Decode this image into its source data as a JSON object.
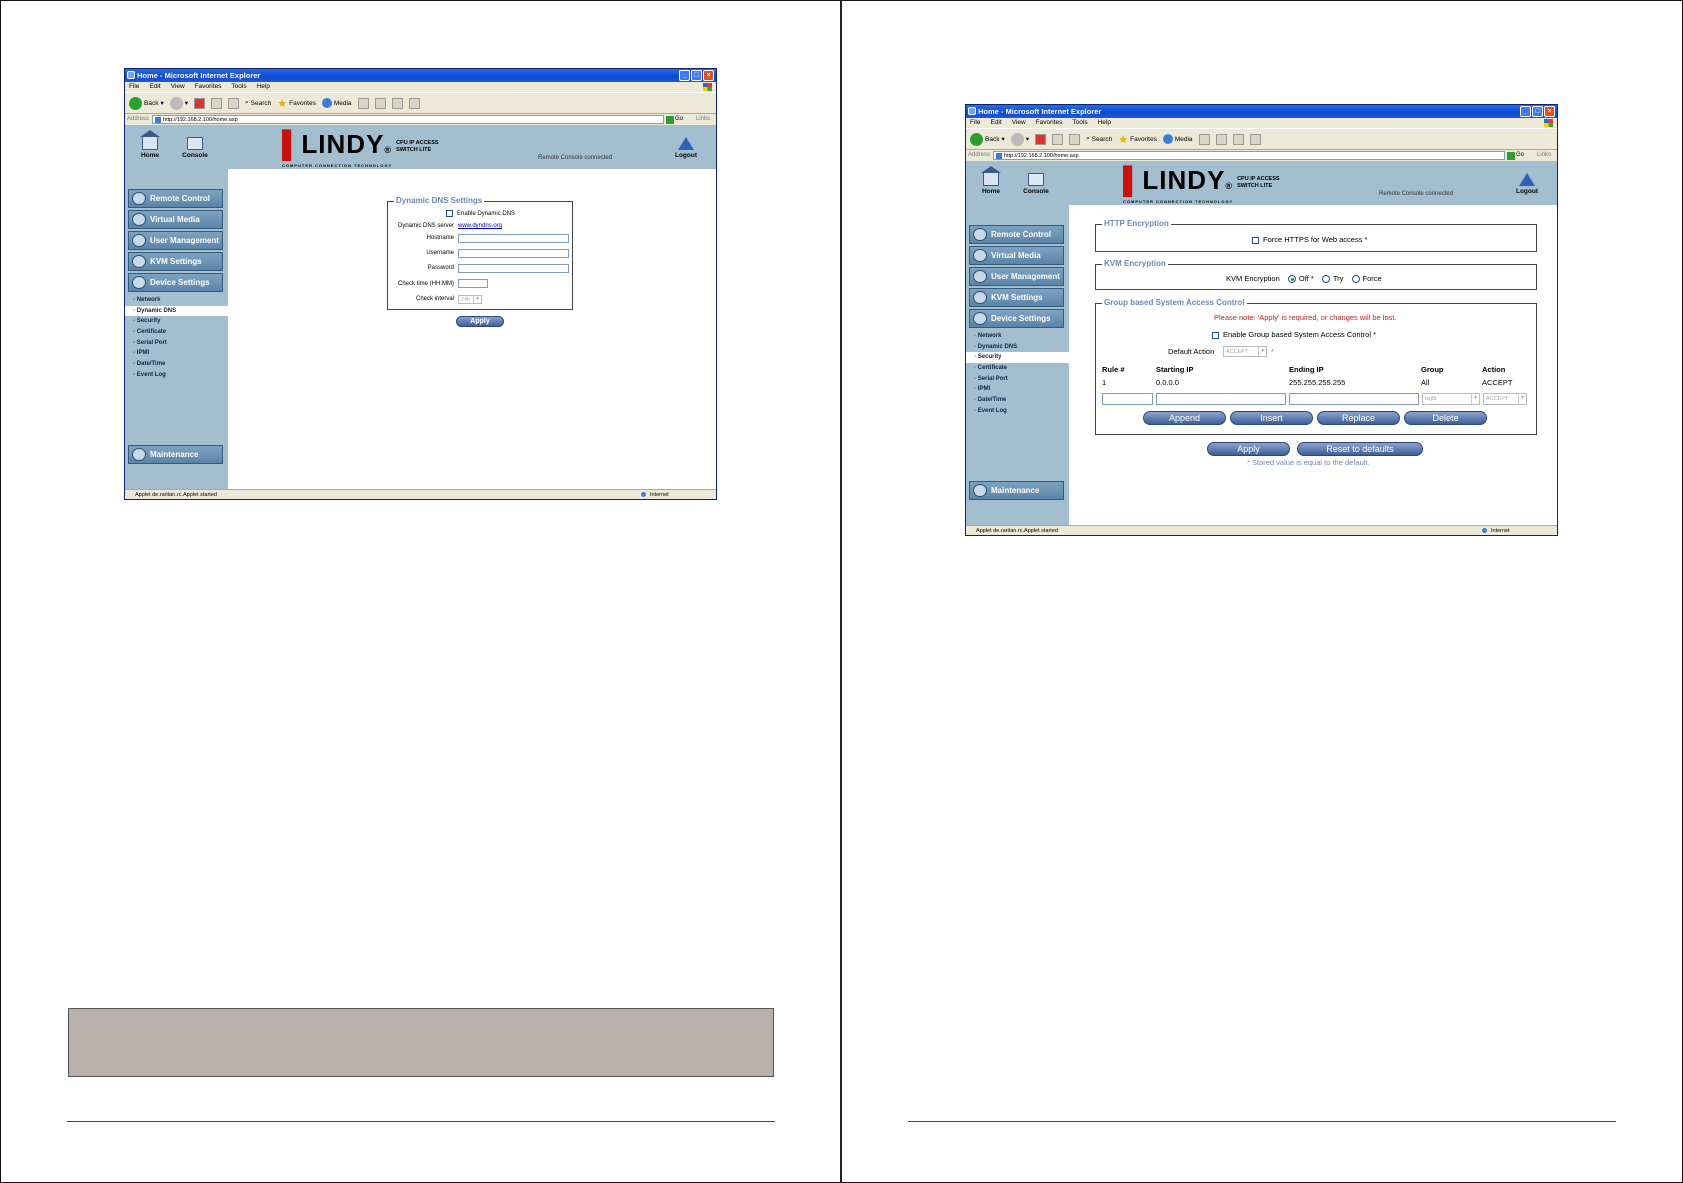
{
  "left": {
    "window": {
      "title": "Home - Microsoft Internet Explorer",
      "menu": [
        "File",
        "Edit",
        "View",
        "Favorites",
        "Tools",
        "Help"
      ],
      "toolbar": {
        "back": "Back",
        "search": "Search",
        "favorites": "Favorites",
        "media": "Media"
      },
      "address_label": "Address",
      "url": "http://192.168.2.100/home.asp",
      "go": "Go",
      "links": "Links",
      "status": "Applet de.raritan.rc.Applet started",
      "zone": "Internet"
    },
    "header": {
      "home": "Home",
      "console": "Console",
      "logo_main": "LINDY",
      "logo_sub": "COMPUTER CONNECTION TECHNOLOGY",
      "logo_side_1": "CPU IP ACCESS",
      "logo_side_2": "SWITCH LITE",
      "rc_status": "Remote Console connected",
      "logout": "Logout"
    },
    "sidebar": {
      "remote_control": "Remote Control",
      "virtual_media": "Virtual Media",
      "user_management": "User Management",
      "kvm_settings": "KVM Settings",
      "device_settings": "Device Settings",
      "sub_items": [
        "Network",
        "Dynamic DNS",
        "Security",
        "Certificate",
        "Serial Port",
        "IPMI",
        "Date/Time",
        "Event Log"
      ],
      "active_item": "Dynamic DNS",
      "maintenance": "Maintenance"
    },
    "ddns": {
      "legend": "Dynamic DNS Settings",
      "enable_label": "Enable Dynamic DNS",
      "server_label": "Dynamic DNS server",
      "server_value": "www.dyndns.org",
      "hostname_label": "Hostname",
      "username_label": "Username",
      "password_label": "Password",
      "check_time_label": "Check time (HH:MM)",
      "check_interval_label": "Check interval",
      "check_interval_value": "24h",
      "apply": "Apply"
    }
  },
  "right": {
    "window": {
      "title": "Home - Microsoft Internet Explorer",
      "menu": [
        "File",
        "Edit",
        "View",
        "Favorites",
        "Tools",
        "Help"
      ],
      "toolbar": {
        "back": "Back",
        "search": "Search",
        "favorites": "Favorites",
        "media": "Media"
      },
      "address_label": "Address",
      "url": "http://192.168.2.100/home.asp",
      "go": "Go",
      "links": "Links",
      "status": "Applet de.raritan.rc.Applet started",
      "zone": "Internet"
    },
    "header": {
      "home": "Home",
      "console": "Console",
      "logo_main": "LINDY",
      "logo_sub": "COMPUTER CONNECTION TECHNOLOGY",
      "logo_side_1": "CPU IP ACCESS",
      "logo_side_2": "SWITCH LITE",
      "rc_status": "Remote Console connected",
      "logout": "Logout"
    },
    "sidebar": {
      "remote_control": "Remote Control",
      "virtual_media": "Virtual Media",
      "user_management": "User Management",
      "kvm_settings": "KVM Settings",
      "device_settings": "Device Settings",
      "sub_items": [
        "Network",
        "Dynamic DNS",
        "Security",
        "Certificate",
        "Serial Port",
        "IPMI",
        "Date/Time",
        "Event Log"
      ],
      "active_item": "Security",
      "maintenance": "Maintenance"
    },
    "security": {
      "http_legend": "HTTP Encryption",
      "force_https_label": "Force HTTPS for Web access *",
      "kvm_legend": "KVM Encryption",
      "kvm_label": "KVM Encryption",
      "kvm_options": [
        "Off *",
        "Try",
        "Force"
      ],
      "kvm_selected": "Off *",
      "gbsac_legend": "Group based System Access Control",
      "note": "Please note: 'Apply' is required, or changes will be lost.",
      "enable_gbsac_label": "Enable Group based System Access Control *",
      "default_action_label": "Default Action",
      "default_action_value": "ACCEPT",
      "default_action_star": "*",
      "columns": [
        "Rule #",
        "Starting IP",
        "Ending IP",
        "Group",
        "Action"
      ],
      "rows": [
        [
          "1",
          "0.0.0.0",
          "255.255.255.255",
          "All",
          "ACCEPT"
        ]
      ],
      "new_group_value": "lxgfb",
      "new_action_value": "ACCEPT",
      "append": "Append",
      "insert": "Insert",
      "replace": "Replace",
      "delete": "Delete",
      "apply": "Apply",
      "reset": "Reset to defaults",
      "footnote": "* Stored value is equal to the default."
    }
  }
}
